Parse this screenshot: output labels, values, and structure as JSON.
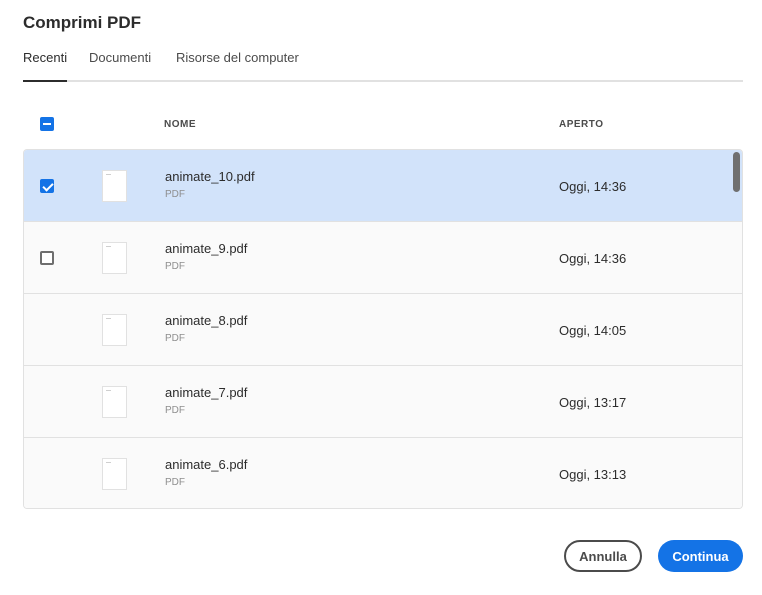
{
  "dialog": {
    "title": "Comprimi PDF"
  },
  "tabs": [
    {
      "label": "Recenti",
      "active": true
    },
    {
      "label": "Documenti",
      "active": false
    },
    {
      "label": "Risorse del computer",
      "active": false
    }
  ],
  "table": {
    "columns": {
      "name": "NOME",
      "opened": "APERTO"
    },
    "select_all_state": "indeterminate",
    "rows": [
      {
        "name": "animate_10.pdf",
        "type": "PDF",
        "opened": "Oggi, 14:36",
        "checkbox": "checked",
        "selected": true
      },
      {
        "name": "animate_9.pdf",
        "type": "PDF",
        "opened": "Oggi, 14:36",
        "checkbox": "unchecked",
        "selected": false
      },
      {
        "name": "animate_8.pdf",
        "type": "PDF",
        "opened": "Oggi, 14:05",
        "checkbox": "none",
        "selected": false
      },
      {
        "name": "animate_7.pdf",
        "type": "PDF",
        "opened": "Oggi, 13:17",
        "checkbox": "none",
        "selected": false
      },
      {
        "name": "animate_6.pdf",
        "type": "PDF",
        "opened": "Oggi, 13:13",
        "checkbox": "none",
        "selected": false
      }
    ]
  },
  "buttons": {
    "cancel": "Annulla",
    "continue": "Continua"
  },
  "colors": {
    "accent": "#1473e6",
    "selected_row": "#d2e3fa"
  }
}
